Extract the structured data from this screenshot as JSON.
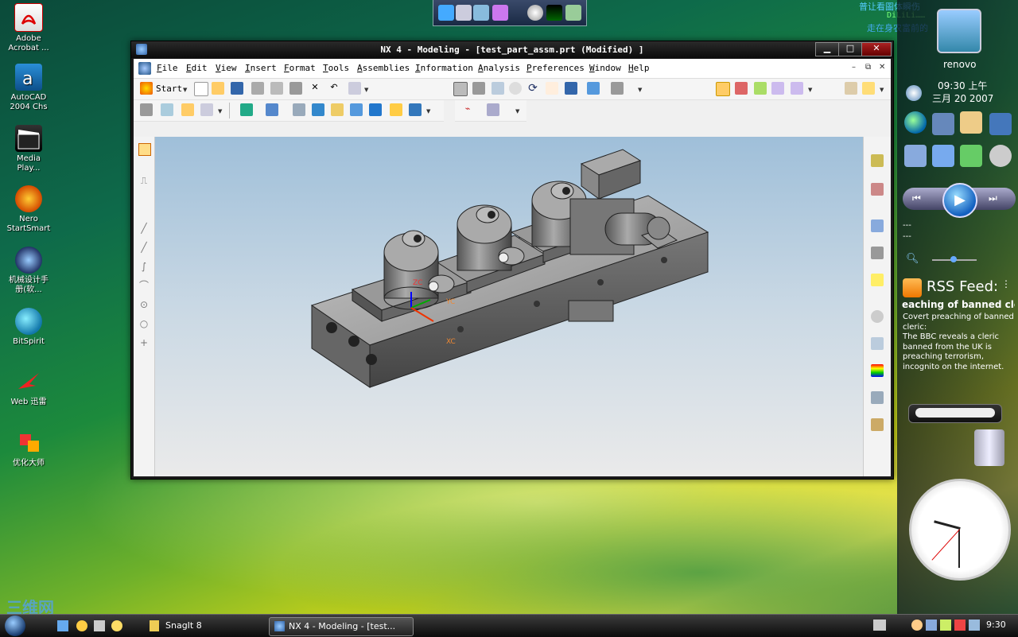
{
  "desktop_icons": [
    {
      "label": "Adobe\nAcrobat ..."
    },
    {
      "label": "AutoCAD\n2004 Chs"
    },
    {
      "label": "Media\nPlay..."
    },
    {
      "label": "Nero\nStartSmart"
    },
    {
      "label": "机械设计手\n册(软..."
    },
    {
      "label": "BitSpirit"
    },
    {
      "label": "Web 迅雷"
    },
    {
      "label": "优化大师"
    }
  ],
  "ticker": {
    "line1": "普让看圖体瞬伤",
    "line2": "DiLiLi……",
    "line3": "走在身农富前的"
  },
  "window": {
    "title": "NX 4 - Modeling - [test_part_assm.prt (Modified) ]",
    "menu": [
      "File",
      "Edit",
      "View",
      "Insert",
      "Format",
      "Tools",
      "Assemblies",
      "Information",
      "Analysis",
      "Preferences",
      "Window",
      "Help"
    ],
    "start_label": "Start",
    "ctrl_min": "▁",
    "ctrl_max": "□",
    "ctrl_close": "✕",
    "mdi_min": "–",
    "mdi_restore": "⧉",
    "mdi_close": "✕"
  },
  "model": {
    "axis_zc": "ZC",
    "axis_yc": "YC",
    "axis_xc": "XC"
  },
  "sidebar": {
    "user": "renovo",
    "time": "09:30 上午",
    "date": "三月 20 2007",
    "media_line1": "---",
    "media_line2": "---",
    "rss_title": "RSS Feed:",
    "rss_headline": "eaching of banned cle",
    "rss_item_title": "Covert preaching of banned cleric:",
    "rss_item_body": "The BBC reveals a cleric banned from the UK is preaching terrorism, incognito on the internet."
  },
  "clock": {
    "hour": 9,
    "minute": 30,
    "second": 37
  },
  "taskbar": {
    "snagit": "SnagIt 8",
    "nx": "NX 4 - Modeling - [test...",
    "time": "9:30"
  },
  "watermark": "三维网"
}
